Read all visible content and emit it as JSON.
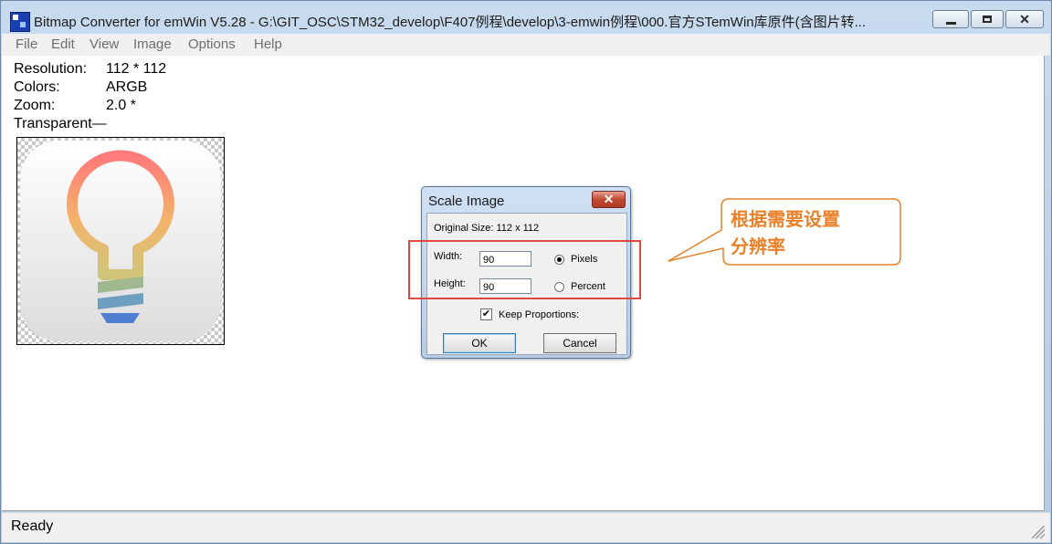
{
  "window": {
    "title": "Bitmap Converter for emWin V5.28 - G:\\GIT_OSC\\STM32_develop\\F407例程\\develop\\3-emwin例程\\000.官方STemWin库原件(含图片转...",
    "icon": "bitmap-converter-app-icon",
    "controls": [
      "minimize-icon",
      "maximize-icon",
      "close-icon"
    ]
  },
  "menu": [
    "File",
    "Edit",
    "View",
    "Image",
    "Options",
    "Help"
  ],
  "info": {
    "resolution_label": "Resolution:",
    "resolution_value": "112 * 112",
    "colors_label": "Colors:",
    "colors_value": "ARGB",
    "zoom_label": "Zoom:",
    "zoom_value": "2.0 *",
    "transparent_label": "Transparent—"
  },
  "preview": {
    "icon": "light-bulb-icon",
    "colors": [
      "#ff7a7a",
      "#f3b46a",
      "#9fb88f",
      "#6f9fbf",
      "#4e7fd0"
    ]
  },
  "dialog": {
    "title": "Scale Image",
    "original_size": "Original Size: 112 x 112",
    "width_label": "Width:",
    "width_value": "90",
    "height_label": "Height:",
    "height_value": "90",
    "pixels_label": "Pixels",
    "percent_label": "Percent",
    "selected_unit": "Pixels",
    "keep_proportions_label": "Keep Proportions:",
    "keep_proportions_checked": true,
    "ok_label": "OK",
    "cancel_label": "Cancel"
  },
  "annotation": {
    "line1": "根据需要设置",
    "line2": "分辨率",
    "highlight_color": "#e0473f",
    "callout_color": "#e8812a"
  },
  "status": {
    "text": "Ready"
  }
}
